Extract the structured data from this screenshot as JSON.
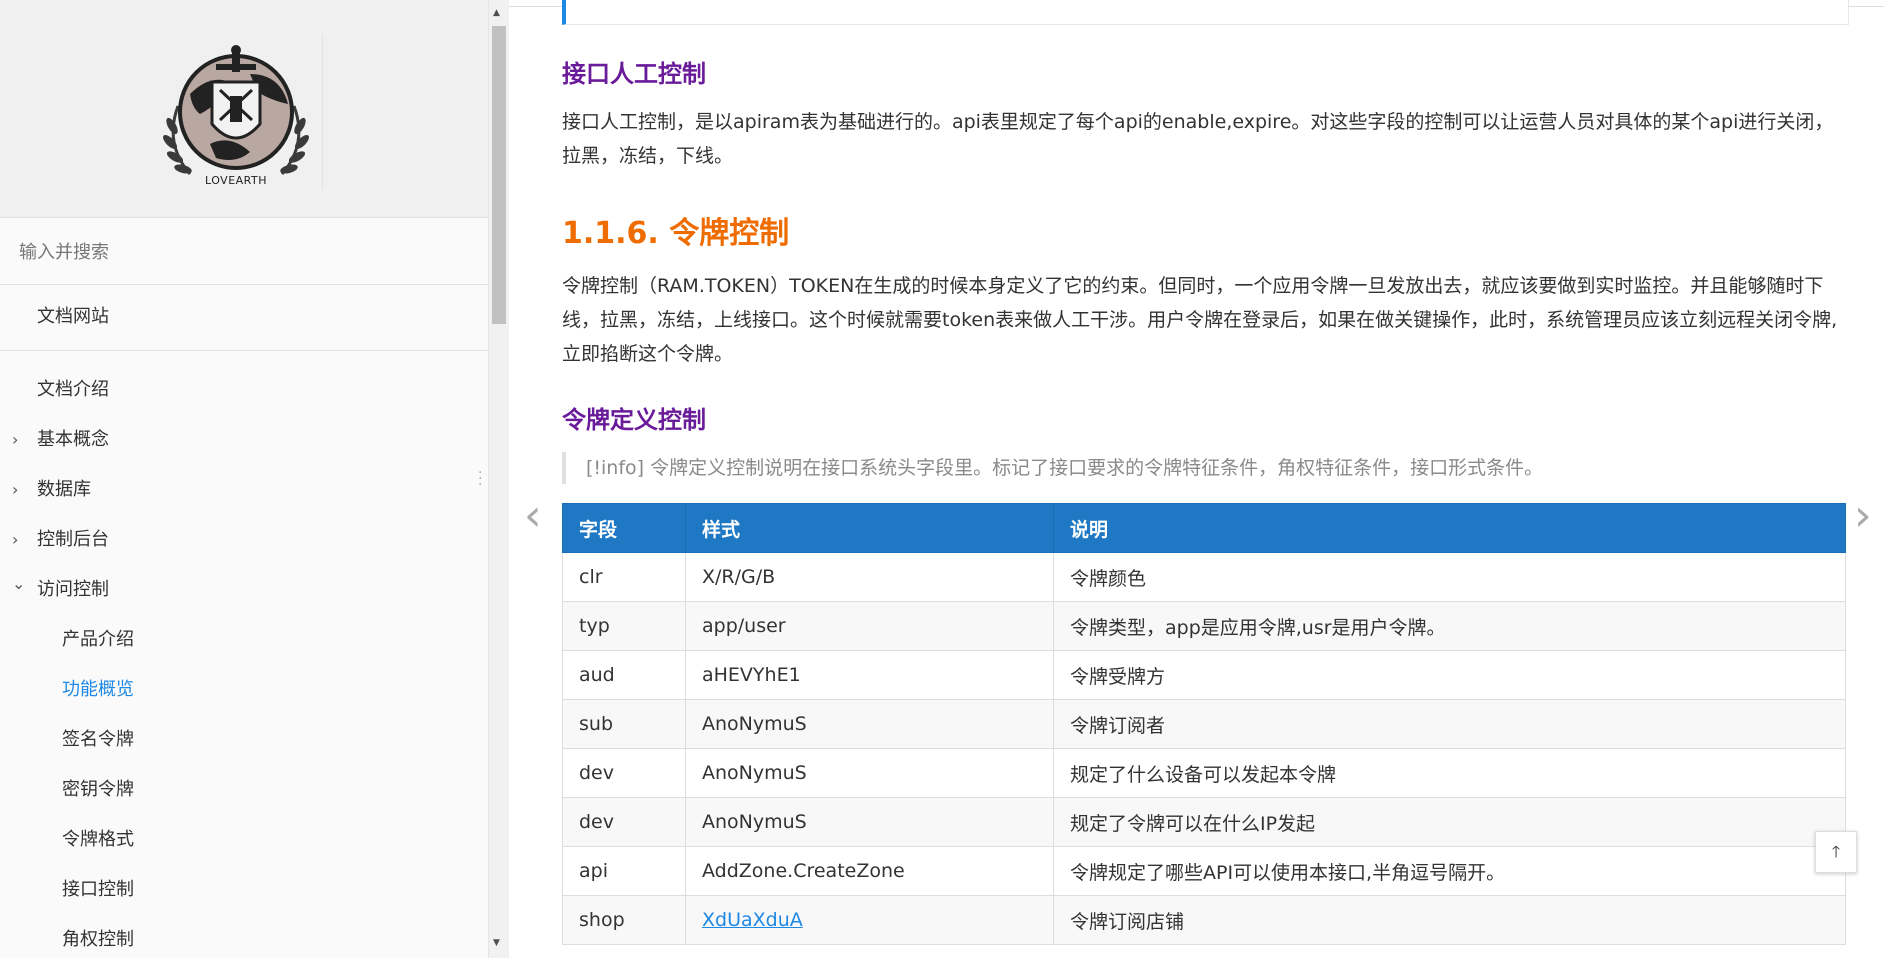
{
  "sidebar": {
    "logo_text": "LOVEARTH",
    "search_placeholder": "输入并搜索",
    "site_link": "文档网站",
    "items": [
      {
        "label": "文档介绍",
        "chevron": ""
      },
      {
        "label": "基本概念",
        "chevron": "›"
      },
      {
        "label": "数据库",
        "chevron": "›"
      },
      {
        "label": "控制后台",
        "chevron": "›"
      },
      {
        "label": "访问控制",
        "chevron": "⌄"
      },
      {
        "label": "产品介绍"
      },
      {
        "label": "功能概览"
      },
      {
        "label": "签名令牌"
      },
      {
        "label": "密钥令牌"
      },
      {
        "label": "令牌格式"
      },
      {
        "label": "接口控制"
      },
      {
        "label": "角权控制"
      }
    ]
  },
  "content": {
    "section1": {
      "heading": "接口人工控制",
      "paragraph": "接口人工控制，是以apiram表为基础进行的。api表里规定了每个api的enable,expire。对这些字段的控制可以让运营人员对具体的某个api进行关闭，拉黑，冻结，下线。"
    },
    "section2": {
      "heading": "1.1.6. 令牌控制",
      "paragraph": "令牌控制（RAM.TOKEN）TOKEN在生成的时候本身定义了它的约束。但同时，一个应用令牌一旦发放出去，就应该要做到实时监控。并且能够随时下线，拉黑，冻结，上线接口。这个时候就需要token表来做人工干涉。用户令牌在登录后，如果在做关键操作，此时，系统管理员应该立刻远程关闭令牌,立即掐断这个令牌。"
    },
    "section3": {
      "heading": "令牌定义控制",
      "info": "[!info] 令牌定义控制说明在接口系统头字段里。标记了接口要求的令牌特征条件，角权特征条件，接口形式条件。"
    },
    "table": {
      "headers": [
        "字段",
        "样式",
        "说明"
      ],
      "rows": [
        [
          "clr",
          "X/R/G/B",
          "令牌颜色"
        ],
        [
          "typ",
          "app/user",
          "令牌类型，app是应用令牌,usr是用户令牌。"
        ],
        [
          "aud",
          "aHEVYhE1",
          "令牌受牌方"
        ],
        [
          "sub",
          "AnoNymuS",
          "令牌订阅者"
        ],
        [
          "dev",
          "AnoNymuS",
          "规定了什么设备可以发起本令牌"
        ],
        [
          "dev",
          "AnoNymuS",
          "规定了令牌可以在什么IP发起"
        ],
        [
          "api",
          "AddZone.CreateZone",
          "令牌规定了哪些API可以使用本接口,半角逗号隔开。"
        ],
        [
          "shop",
          "XdUaXduA",
          "令牌订阅店铺"
        ]
      ]
    }
  },
  "icons": {
    "prev": "‹",
    "next": "›",
    "back_to_top": "🡑",
    "scroll_up": "▲",
    "scroll_down": "▼"
  },
  "colors": {
    "accent": "#1e88e5",
    "heading_purple": "#6a1b9a",
    "heading_orange": "#ef6c00",
    "table_header": "#1e78c3"
  }
}
